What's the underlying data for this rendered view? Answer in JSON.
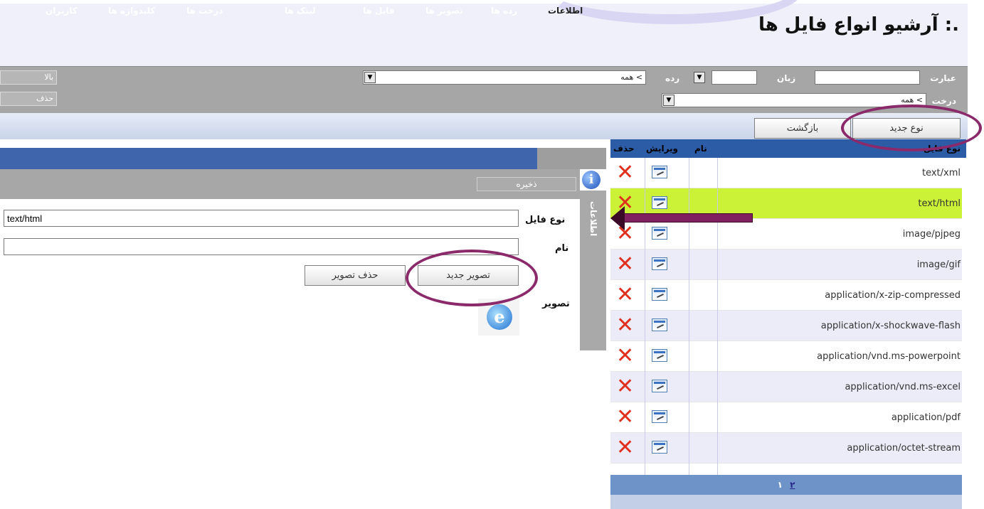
{
  "page": {
    "title": ".: آرشیو انواع فایل ها"
  },
  "filters": {
    "phrase_label": "عبارت",
    "phrase_value": "",
    "language_label": "زبان",
    "language_value": "",
    "category_label": "رده",
    "category_value": "",
    "category_select": "> همه",
    "tree_label": "درخت",
    "tree_select": "> همه",
    "side_buttons": [
      "بالا",
      "حذف"
    ]
  },
  "actions": {
    "new_type": "نوع جدید",
    "back": "بازگشت"
  },
  "list": {
    "columns": {
      "type": "نوع فایل",
      "name": "نام",
      "edit": "ویرایش",
      "delete": "حذف"
    },
    "rows": [
      {
        "type": "text/xml"
      },
      {
        "type": "text/html",
        "selected": true
      },
      {
        "type": "image/pjpeg"
      },
      {
        "type": "image/gif"
      },
      {
        "type": "application/x-zip-compressed"
      },
      {
        "type": "application/x-shockwave-flash"
      },
      {
        "type": "application/vnd.ms-powerpoint"
      },
      {
        "type": "application/vnd.ms-excel"
      },
      {
        "type": "application/pdf"
      },
      {
        "type": "application/octet-stream"
      }
    ],
    "pager": {
      "page1": "۱",
      "page2": "۲"
    }
  },
  "tabs": [
    "اطلاعات",
    "رده ها",
    "تصویر ها",
    "فایل ها",
    "لینک ها",
    "درخت ها",
    "کلیدواژه ها",
    "کاربران"
  ],
  "detail": {
    "save": "ذخیره",
    "info_icon": "info-icon",
    "vertical_tab": "اطلاعات",
    "file_type_label": "نوع فایل",
    "file_type_value": "text/html",
    "name_label": "نام",
    "name_value": "",
    "image_label": "تصویر",
    "new_image": "تصویر جدید",
    "delete_image": "حذف تصویر",
    "image_icon": "ie-icon"
  },
  "colors": {
    "tab_blue": "#3f66ad",
    "selected_row": "#ccf238",
    "annotation": "#8b2a6b"
  }
}
